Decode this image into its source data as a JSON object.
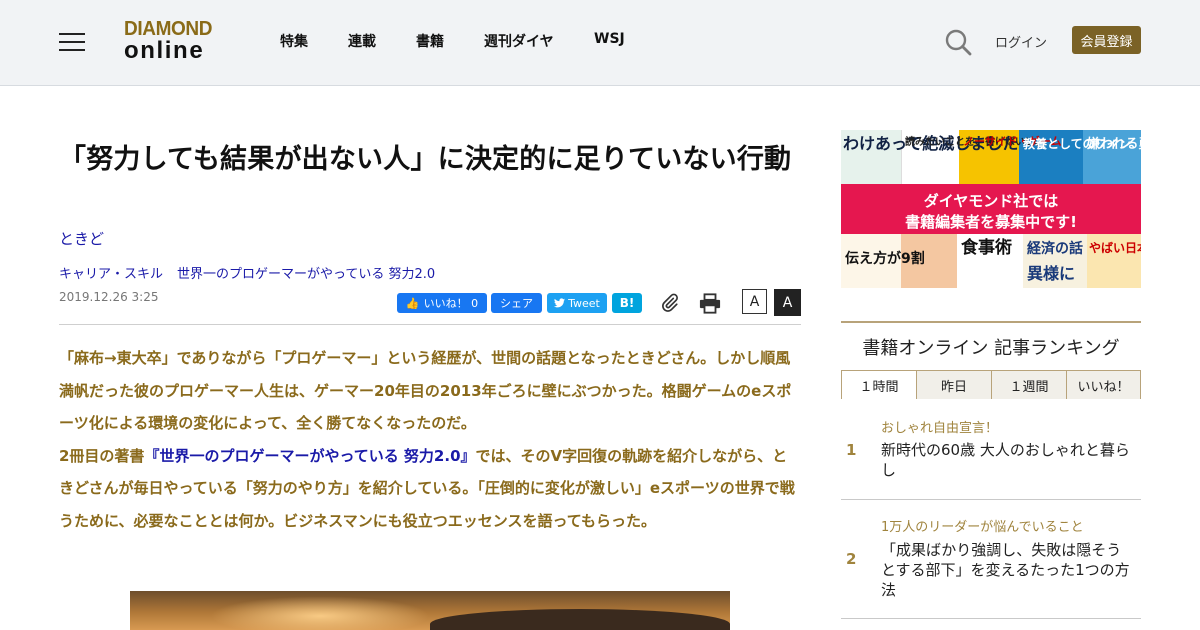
{
  "header": {
    "menu_icon": "hamburger-menu-icon",
    "logo": {
      "top": "DIAMOND",
      "bottom": "online"
    },
    "nav": [
      "特集",
      "連載",
      "書籍",
      "週刊ダイヤ",
      "WSJ"
    ],
    "search_icon": "search-icon",
    "login_label": "ログイン",
    "register_label": "会員登録"
  },
  "article": {
    "title": "「努力しても結果が出ない人」に決定的に足りていない行動",
    "author": "ときど",
    "category": "キャリア・スキル",
    "series": "世界一のプロゲーマーがやっている 努力2.0",
    "date": "2019.12.26 3:25",
    "share": {
      "facebook_like": "いいね！ 0",
      "facebook_share": "シェア",
      "tweet": "Tweet",
      "hatena": "B!"
    },
    "font_small": "A",
    "font_large": "A",
    "lead": {
      "p1": "「麻布→東大卒」でありながら「プロゲーマー」という経歴が、世間の話題となったときどさん。しかし順風満帆だった彼のプロゲーマー人生は、ゲーマー20年目の2013年ごろに壁にぶつかった。格闘ゲームのeスポーツ化による環境の変化によって、全く勝てなくなったのだ。",
      "p2_prefix": "2冊目の著書",
      "p2_book": "『世界一のプロゲーマーがやっている 努力2.0』",
      "p2_suffix": "では、そのV字回復の軌跡を紹介しながら、ときどさんが毎日やっている「努力のやり方」を紹介している。「圧倒的に変化が激しい」eスポーツの世界で戦うために、必要なこととは何か。ビジネスマンにも役立つエッセンスを語ってもらった。"
    }
  },
  "sidebar": {
    "banner": {
      "line1": "ダイヤモンド社では",
      "line2": "書籍編集者を募集中です!",
      "book_texts": [
        "わけあって絶滅しました",
        "読みたいことを、書けばいい。",
        "ノーサイド・ゲーム",
        "教養としてのワイン",
        "嫌われる勇気",
        "伝え方が9割",
        "食事術",
        "経済の話",
        "やばい日本史",
        "異様に"
      ]
    },
    "ranking": {
      "title": "書籍オンライン 記事ランキング",
      "tabs": [
        "１時間",
        "昨日",
        "１週間",
        "いいね！"
      ],
      "items": [
        {
          "rank": "1",
          "series": "おしゃれ自由宣言！",
          "title": "新時代の60歳 大人のおしゃれと暮らし"
        },
        {
          "rank": "2",
          "series": "1万人のリーダーが悩んでいること",
          "title": "「成果ばかり強調し、失敗は隠そうとする部下」を変えるたった1つの方法"
        }
      ]
    }
  },
  "colors": {
    "gold": "#8a6a1c",
    "link_blue": "#1a1aa8",
    "register_bg": "#7b6226",
    "banner_red": "#e5174f",
    "facebook": "#1877f2",
    "twitter": "#1da1f2",
    "hatena": "#00a4de"
  }
}
